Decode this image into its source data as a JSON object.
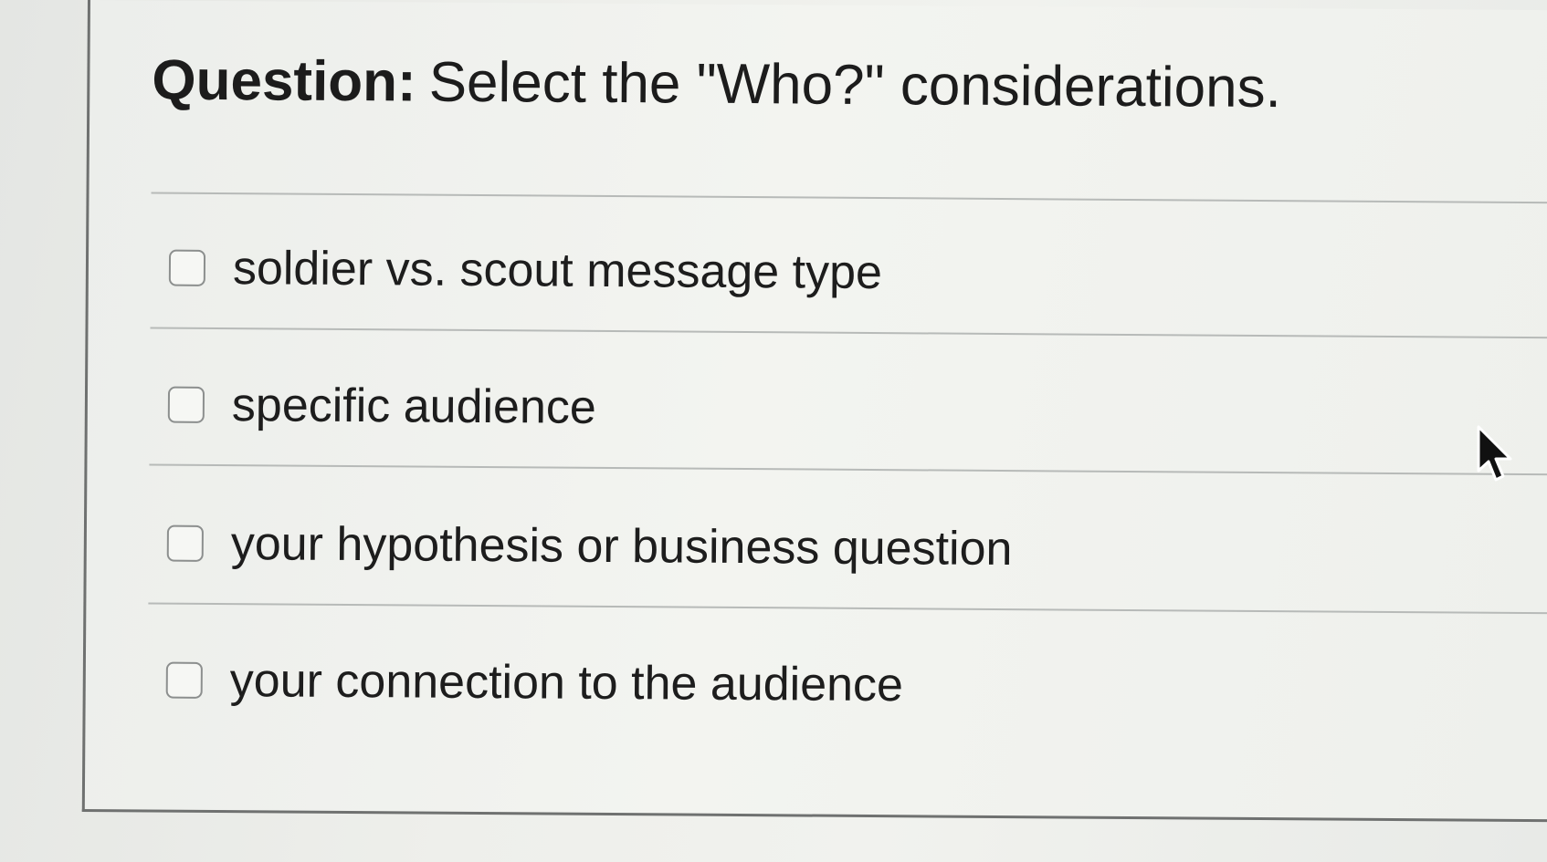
{
  "question": {
    "label": "Question:",
    "text": "Select the \"Who?\" considerations."
  },
  "answers": [
    {
      "label": "soldier vs. scout message type",
      "checked": false
    },
    {
      "label": "specific audience",
      "checked": false
    },
    {
      "label": "your hypothesis or business question",
      "checked": false
    },
    {
      "label": "your connection to the audience",
      "checked": false
    }
  ],
  "cursor": {
    "icon": "arrow-cursor-icon"
  }
}
